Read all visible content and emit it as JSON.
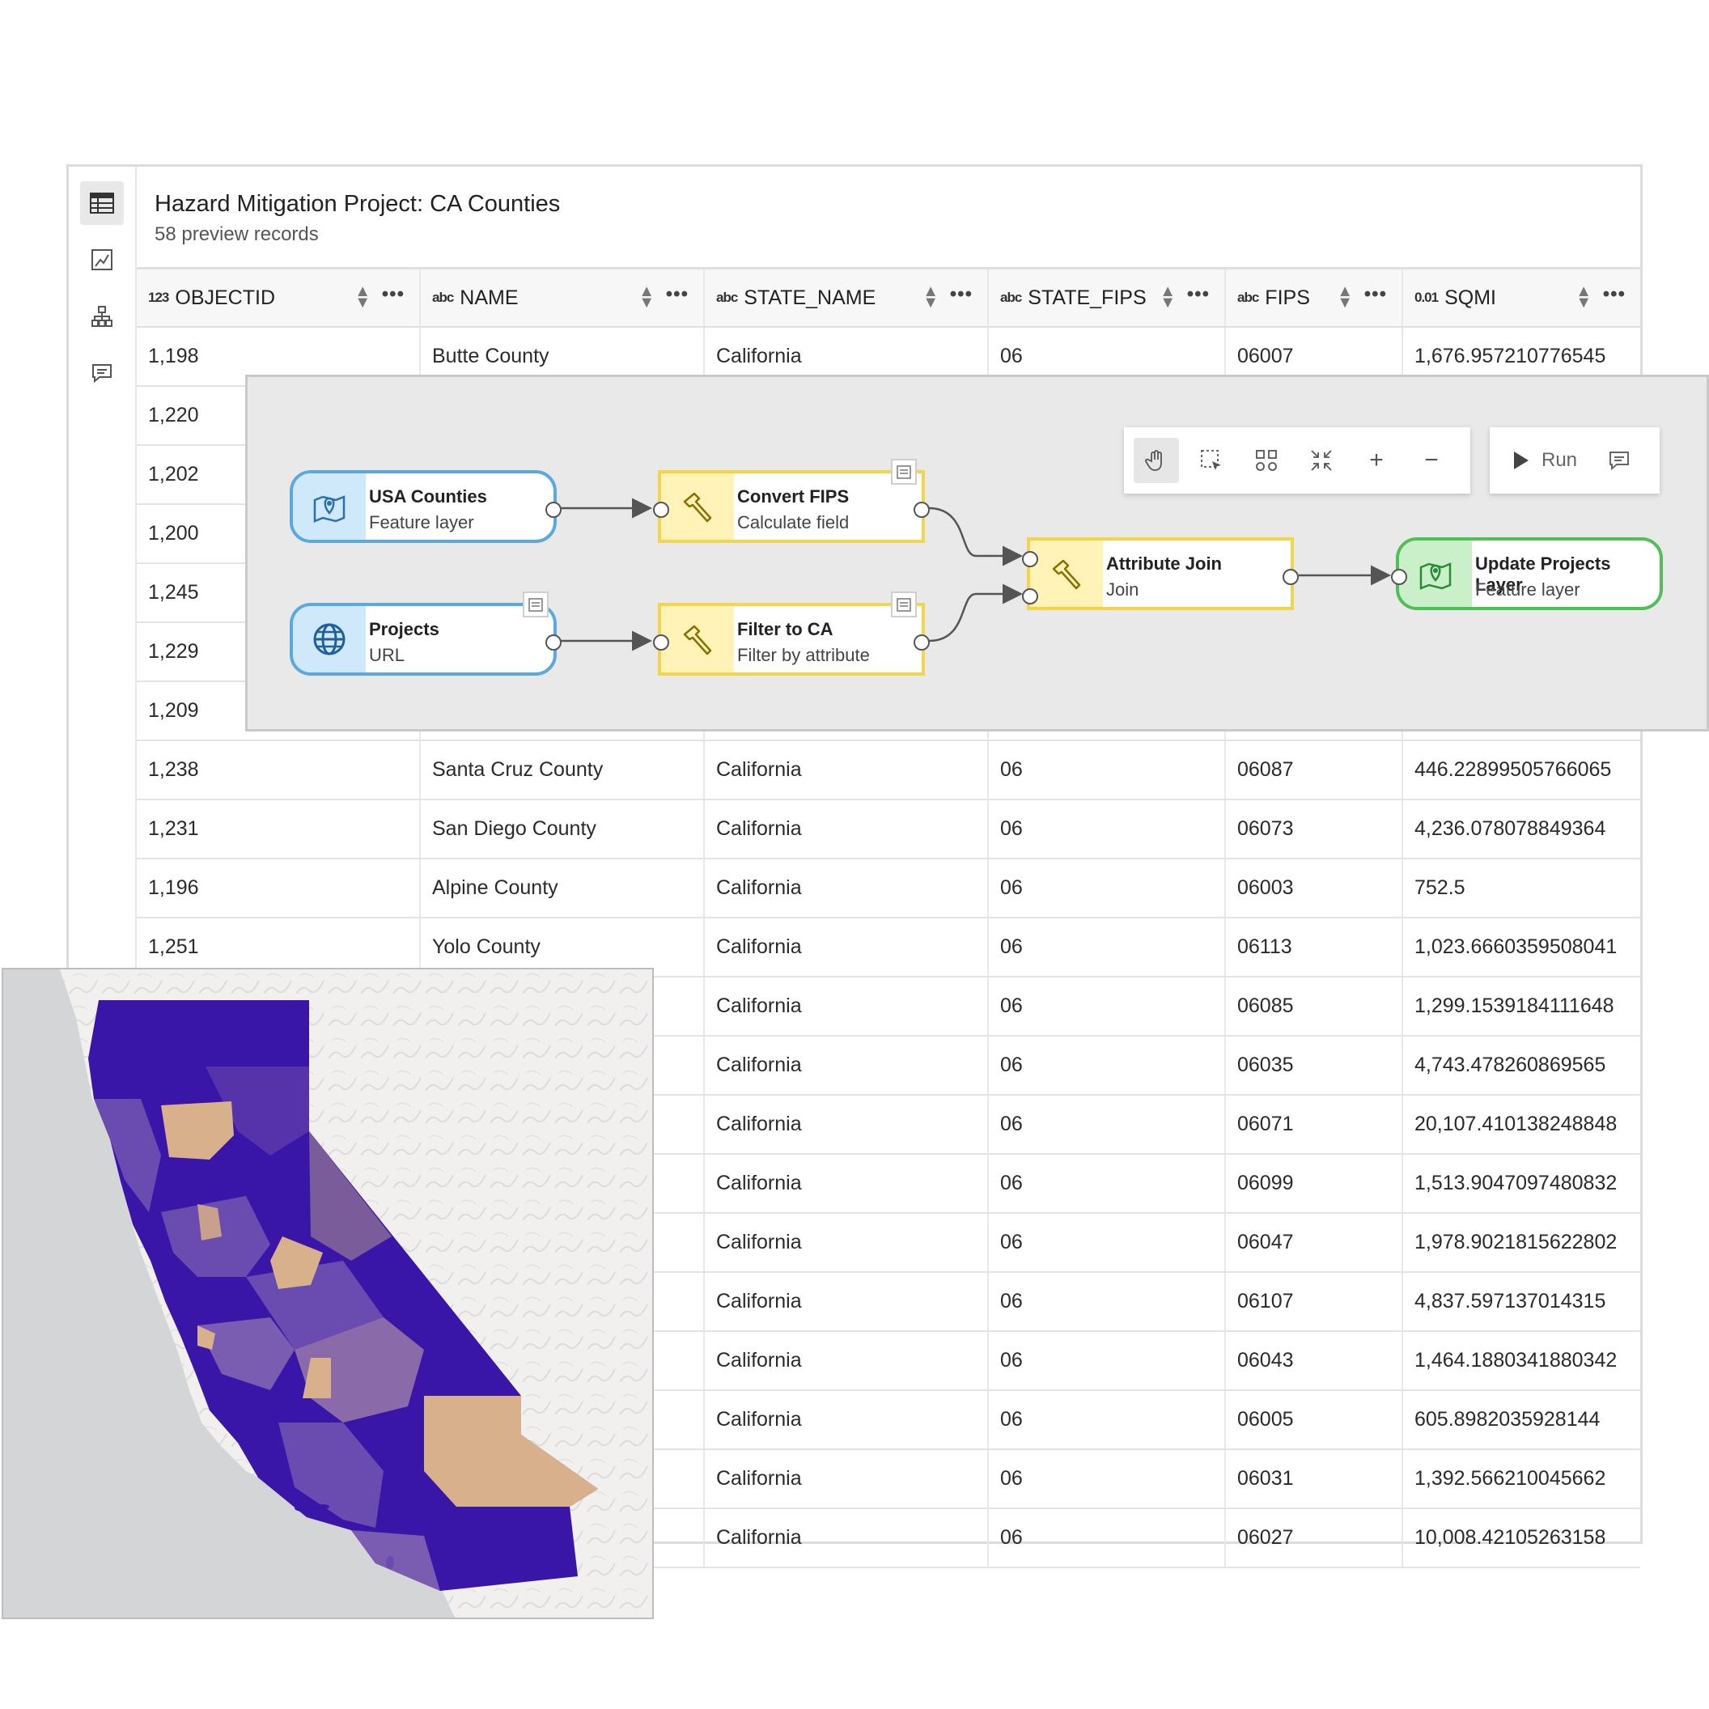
{
  "table": {
    "title": "Hazard Mitigation Project: CA Counties",
    "subtitle": "58 preview records",
    "columns": [
      {
        "type": "123",
        "name": "OBJECTID"
      },
      {
        "type": "abc",
        "name": "NAME"
      },
      {
        "type": "abc",
        "name": "STATE_NAME"
      },
      {
        "type": "abc",
        "name": "STATE_FIPS"
      },
      {
        "type": "abc",
        "name": "FIPS"
      },
      {
        "type": "0.01",
        "name": "SQMI"
      }
    ],
    "rows": [
      [
        "1,198",
        "Butte County",
        "California",
        "06",
        "06007",
        "1,676.957210776545"
      ],
      [
        "1,220",
        "",
        "",
        "",
        "",
        ""
      ],
      [
        "1,202",
        "",
        "",
        "",
        "",
        ""
      ],
      [
        "1,200",
        "",
        "",
        "",
        "",
        ""
      ],
      [
        "1,245",
        "",
        "",
        "",
        "",
        ""
      ],
      [
        "1,229",
        "",
        "",
        "",
        "",
        ""
      ],
      [
        "1,209",
        "",
        "",
        "",
        "",
        ""
      ],
      [
        "1,238",
        "Santa Cruz County",
        "California",
        "06",
        "06087",
        "446.22899505766065"
      ],
      [
        "1,231",
        "San Diego County",
        "California",
        "06",
        "06073",
        "4,236.078078849364"
      ],
      [
        "1,196",
        "Alpine County",
        "California",
        "06",
        "06003",
        "752.5"
      ],
      [
        "1,251",
        "Yolo County",
        "California",
        "06",
        "06113",
        "1,023.6660359508041"
      ],
      [
        "",
        "",
        "California",
        "06",
        "06085",
        "1,299.1539184111648"
      ],
      [
        "",
        "",
        "California",
        "06",
        "06035",
        "4,743.478260869565"
      ],
      [
        "",
        "",
        "California",
        "06",
        "06071",
        "20,107.410138248848"
      ],
      [
        "",
        "",
        "California",
        "06",
        "06099",
        "1,513.9047097480832"
      ],
      [
        "",
        "",
        "California",
        "06",
        "06047",
        "1,978.9021815622802"
      ],
      [
        "",
        "",
        "California",
        "06",
        "06107",
        "4,837.597137014315"
      ],
      [
        "",
        "",
        "California",
        "06",
        "06043",
        "1,464.1880341880342"
      ],
      [
        "",
        "",
        "California",
        "06",
        "06005",
        "605.8982035928144"
      ],
      [
        "",
        "",
        "California",
        "06",
        "06031",
        "1,392.566210045662"
      ],
      [
        "",
        "",
        "California",
        "06",
        "06027",
        "10,008.42105263158"
      ]
    ]
  },
  "sidebar": {
    "items": [
      {
        "icon": "table-icon",
        "active": true
      },
      {
        "icon": "chart-icon"
      },
      {
        "icon": "model-icon"
      },
      {
        "icon": "comment-icon"
      }
    ]
  },
  "model": {
    "nodes": {
      "usa_counties": {
        "title": "USA Counties",
        "subtitle": "Feature layer",
        "icon": "map-pin-icon"
      },
      "projects": {
        "title": "Projects",
        "subtitle": "URL",
        "icon": "globe-icon"
      },
      "convert_fips": {
        "title": "Convert FIPS",
        "subtitle": "Calculate field",
        "icon": "hammer-icon"
      },
      "filter_ca": {
        "title": "Filter to CA",
        "subtitle": "Filter by attribute",
        "icon": "hammer-icon"
      },
      "attribute_join": {
        "title": "Attribute Join",
        "subtitle": "Join",
        "icon": "hammer-icon"
      },
      "update_projects": {
        "title": "Update Projects Layer",
        "subtitle": "Feature layer",
        "icon": "map-pin-icon"
      }
    },
    "toolbar": {
      "tools": [
        "pan-icon",
        "select-icon",
        "auto-layout-icon",
        "fit-icon",
        "zoom-in-icon",
        "zoom-out-icon"
      ],
      "run_label": "Run"
    }
  },
  "colors": {
    "input_blue": "#5aa8e0",
    "tool_yellow": "#f2d54a",
    "output_green": "#4fbf57",
    "map_purple_dark": "#3a16a8",
    "map_purple_mid": "#6a4bb0",
    "map_tan": "#d9b08c"
  }
}
